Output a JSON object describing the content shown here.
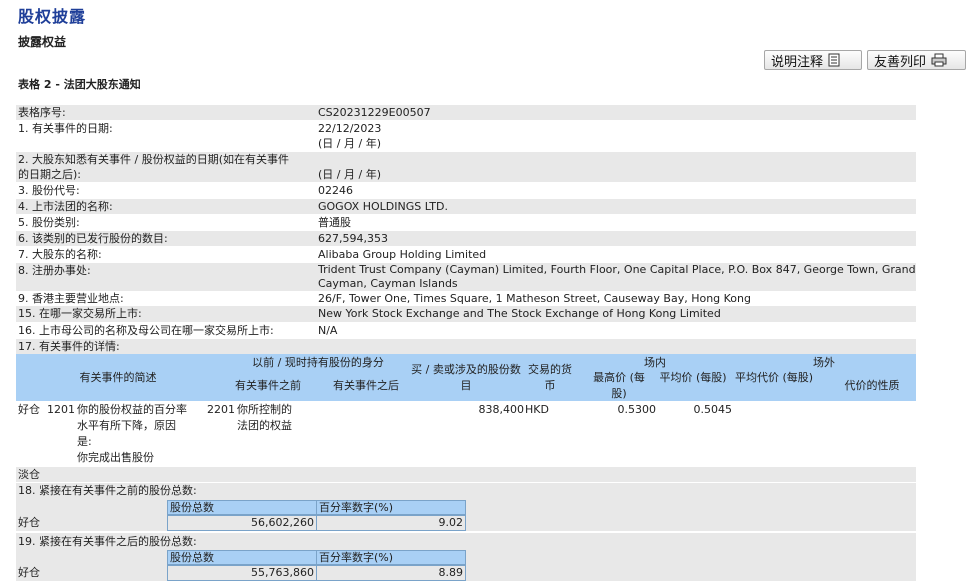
{
  "page": {
    "title": "股权披露",
    "subtitle": "披露权益",
    "table_title": "表格 2 - 法团大股东通知"
  },
  "buttons": {
    "notes": "说明注释",
    "print": "友善列印"
  },
  "fields": [
    {
      "label": "表格序号:",
      "value": "CS20231229E00507"
    },
    {
      "label": "1. 有关事件的日期:",
      "value": "22/12/2023",
      "value2": "(日 / 月 / 年)"
    },
    {
      "label": "2. 大股东知悉有关事件 / 股份权益的日期(如在有关事件",
      "label2": "的日期之后):",
      "value": "(日 / 月 / 年)"
    },
    {
      "label": "3. 股份代号:",
      "value": "02246"
    },
    {
      "label": "4. 上市法团的名称:",
      "value": "GOGOX HOLDINGS LTD."
    },
    {
      "label": "5. 股份类别:",
      "value": "普通股"
    },
    {
      "label": "6. 该类别的已发行股份的数目:",
      "value": "627,594,353"
    },
    {
      "label": "7. 大股东的名称:",
      "value": "Alibaba Group Holding Limited"
    },
    {
      "label": "8. 注册办事处:",
      "value": "Trident Trust Company (Cayman) Limited, Fourth Floor, One Capital Place, P.O. Box 847, George Town, Grand",
      "value2": "Cayman, Cayman Islands"
    },
    {
      "label": "9. 香港主要营业地点:",
      "value": "26/F, Tower One, Times Square, 1 Matheson Street, Causeway Bay, Hong Kong"
    },
    {
      "label": "15. 在哪一家交易所上市:",
      "value": "New York Stock Exchange and The Stock Exchange of Hong Kong Limited"
    },
    {
      "label": "16. 上市母公司的名称及母公司在哪一家交易所上市:",
      "value": "N/A"
    },
    {
      "label": "17. 有关事件的详情:"
    }
  ],
  "event_table": {
    "headers": {
      "desc": "有关事件的简述",
      "capacity_group": "以前 / 现时持有股份的身分",
      "before": "有关事件之前",
      "after": "有关事件之后",
      "shares": "买 / 卖或涉及的股份数目",
      "currency": "交易的货币",
      "on_exchange": "场内",
      "off_exchange": "场外",
      "highest": "最高价 (每股)",
      "average": "平均价 (每股)",
      "avg_consideration": "平均代价 (每股)",
      "nature": "代价的性质"
    },
    "rows": [
      {
        "position": "好仓",
        "code": "1201",
        "desc": [
          "你的股份权益的百分率",
          "水平有所下降，原因",
          "是:",
          "你完成出售股份"
        ],
        "before_code": "2201",
        "before_desc": [
          "你所控制的",
          "法团的权益"
        ],
        "shares": "838,400",
        "currency": "HKD",
        "highest": "0.5300",
        "average": "0.5045"
      }
    ]
  },
  "lending_pool": "淡仓",
  "section18": {
    "label": "18. 紧接在有关事件之前的股份总数:",
    "col1": "股份总数",
    "col2": "百分率数字(%)",
    "row_label": "好仓",
    "shares": "56,602,260",
    "percent": "9.02"
  },
  "section19": {
    "label": "19. 紧接在有关事件之后的股份总数:",
    "col1": "股份总数",
    "col2": "百分率数字(%)",
    "row_label": "好仓",
    "shares": "55,763,860",
    "percent": "8.89"
  },
  "icons": {
    "notes": "document-icon",
    "print": "printer-icon"
  }
}
